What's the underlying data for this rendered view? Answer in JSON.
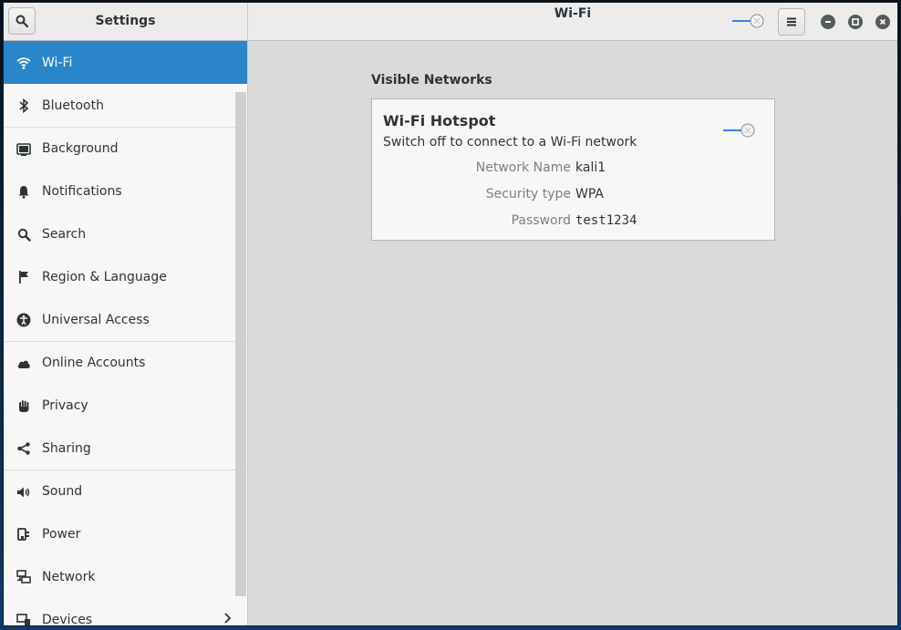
{
  "window": {
    "sidebar_title": "Settings",
    "panel_title": "Wi-Fi"
  },
  "header": {
    "search_icon": "search-icon",
    "menu_icon": "hamburger-menu-icon",
    "wifi_switch_state": "on",
    "window_controls": [
      "minimize-icon",
      "maximize-icon",
      "close-icon"
    ]
  },
  "sidebar": {
    "items": [
      {
        "label": "Wi-Fi",
        "icon": "wifi-icon",
        "active": true
      },
      {
        "label": "Bluetooth",
        "icon": "bluetooth-icon"
      },
      {
        "label": "Background",
        "icon": "background-icon"
      },
      {
        "label": "Notifications",
        "icon": "bell-icon"
      },
      {
        "label": "Search",
        "icon": "search-icon"
      },
      {
        "label": "Region & Language",
        "icon": "flag-icon"
      },
      {
        "label": "Universal Access",
        "icon": "accessibility-icon"
      },
      {
        "label": "Online Accounts",
        "icon": "cloud-icon"
      },
      {
        "label": "Privacy",
        "icon": "hand-icon"
      },
      {
        "label": "Sharing",
        "icon": "share-icon"
      },
      {
        "label": "Sound",
        "icon": "speaker-icon"
      },
      {
        "label": "Power",
        "icon": "power-plug-icon"
      },
      {
        "label": "Network",
        "icon": "network-icon"
      },
      {
        "label": "Devices",
        "icon": "devices-icon",
        "has_submenu": true
      }
    ]
  },
  "content": {
    "section_title": "Visible Networks",
    "hotspot": {
      "title": "Wi-Fi Hotspot",
      "subtitle": "Switch off to connect to a Wi-Fi network",
      "switch_state": "on",
      "fields": [
        {
          "key": "Network Name",
          "value": "kali1"
        },
        {
          "key": "Security type",
          "value": "WPA"
        },
        {
          "key": "Password",
          "value": "test1234"
        }
      ]
    }
  },
  "colors": {
    "accent": "#2a86c9",
    "sidebar_bg": "#f7f7f7",
    "content_bg": "#dadada"
  }
}
